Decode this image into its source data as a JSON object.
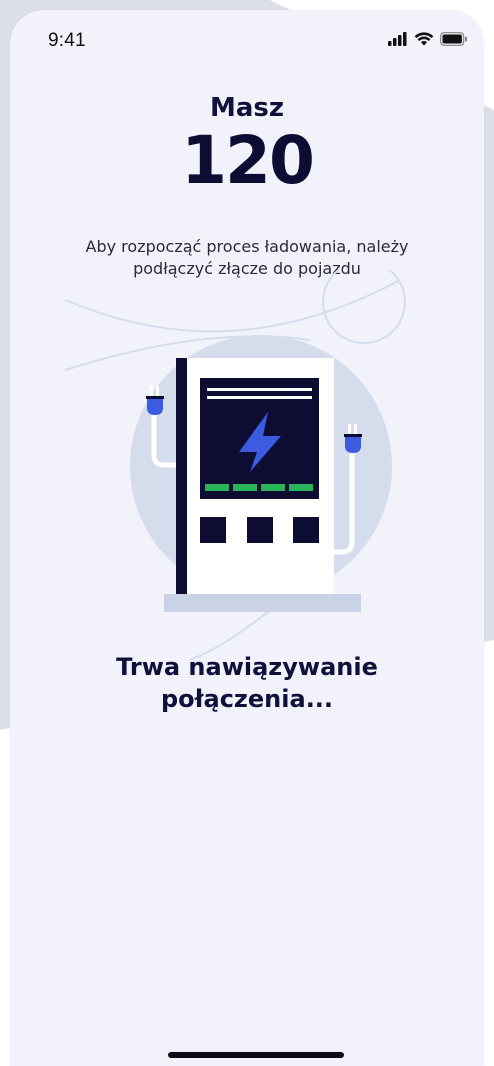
{
  "status_bar": {
    "time": "9:41",
    "icons": [
      "signal-icon",
      "wifi-icon",
      "battery-icon"
    ]
  },
  "header": {
    "title": "Masz",
    "value": "120"
  },
  "instruction": "Aby rozpocząć proces ładowania, należy podłączyć złącze do pojazdu",
  "status": {
    "connecting": "Trwa nawiązywanie połączenia..."
  },
  "colors": {
    "background": "#f1f2fa",
    "dark": "#0d0d33",
    "accent_blue": "#3b5be0",
    "accent_green": "#29b35a",
    "circle": "#d5dded"
  }
}
